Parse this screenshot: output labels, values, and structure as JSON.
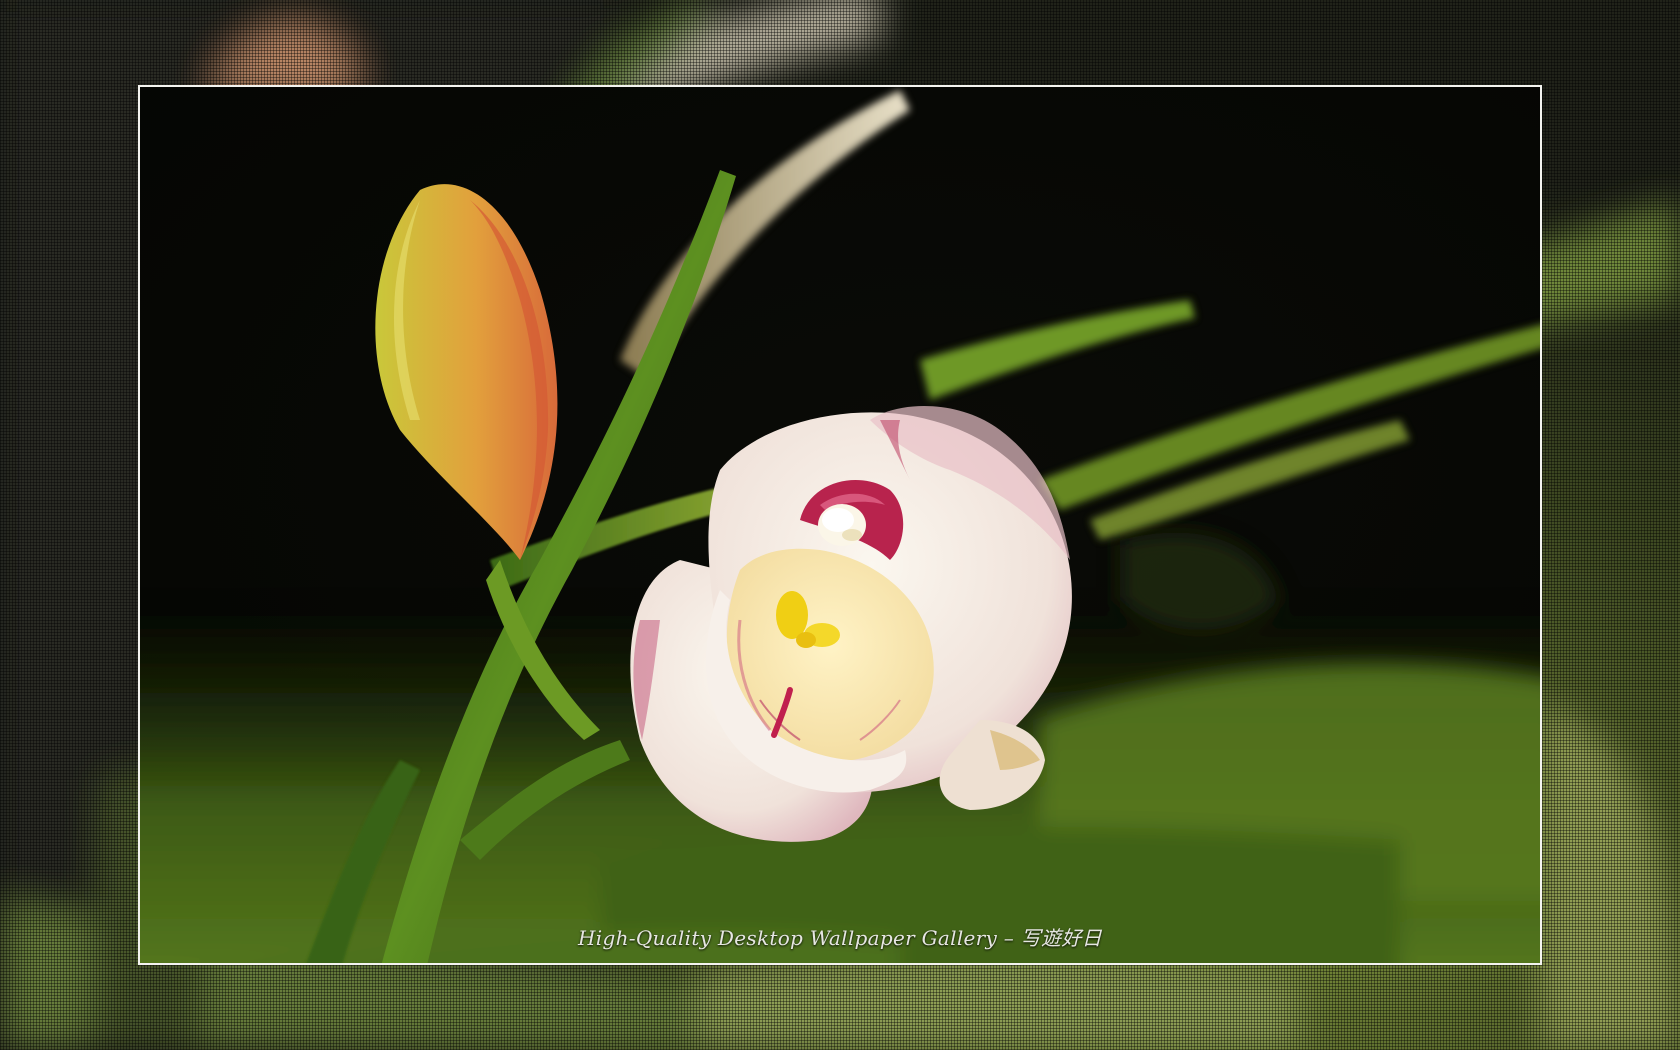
{
  "caption": {
    "text": "High-Quality Desktop Wallpaper Gallery – 写遊好日"
  },
  "palette": {
    "frame_border": "#f4f4f0",
    "background_dark": "#050604",
    "leaf_green": "#5f8a1e",
    "petal_white": "#f4eee6",
    "petal_pink": "#d98aa0",
    "lip_magenta": "#b8234d",
    "column_yellow": "#f2d21a",
    "bud_orange": "#e0882e"
  }
}
